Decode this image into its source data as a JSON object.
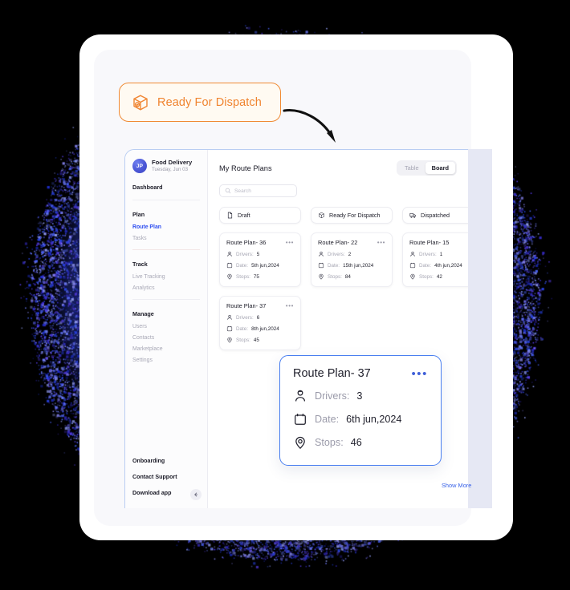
{
  "callout": {
    "label": "Ready For Dispatch",
    "icon": "package-box-icon",
    "accent": "#f08430",
    "bg": "#fffaf2"
  },
  "annotation": {
    "icon": "curved-arrow-icon"
  },
  "sidebar": {
    "profile": {
      "initials": "JP",
      "name": "Food Delivery",
      "date": "Tuesday, Jun 03"
    },
    "dashboard_label": "Dashboard",
    "groups": [
      {
        "title": "Plan",
        "items": [
          {
            "label": "Route Plan",
            "active": true
          },
          {
            "label": "Tasks",
            "active": false
          }
        ]
      },
      {
        "title": "Track",
        "items": [
          {
            "label": "Live Tracking",
            "active": false
          },
          {
            "label": "Analytics",
            "active": false
          }
        ]
      },
      {
        "title": "Manage",
        "items": [
          {
            "label": "Users",
            "active": false
          },
          {
            "label": "Contacts",
            "active": false
          },
          {
            "label": "Marketplace",
            "active": false
          },
          {
            "label": "Settings",
            "active": false
          }
        ]
      }
    ],
    "bottom": [
      {
        "label": "Onboarding"
      },
      {
        "label": "Contact Support"
      },
      {
        "label": "Download app"
      }
    ],
    "collapse_icon": "arrow-left-icon"
  },
  "main": {
    "title": "My Route Plans",
    "view_toggle": {
      "options": [
        "Table",
        "Board"
      ],
      "selected": "Board"
    },
    "search": {
      "placeholder": "Search",
      "value": "",
      "icon": "search-icon"
    },
    "columns": [
      {
        "title": "Draft",
        "icon": "file-icon",
        "cards": [
          {
            "title": "Route Plan- 36",
            "drivers_label": "Drivers:",
            "drivers": "5",
            "date_label": "Date:",
            "date": "5th jun,2024",
            "stops_label": "Stops:",
            "stops": "75",
            "menu_icon": "more-horizontal-icon"
          },
          {
            "title": "Route Plan- 37",
            "drivers_label": "Drivers:",
            "drivers": "6",
            "date_label": "Date:",
            "date": "8th jun,2024",
            "stops_label": "Stops:",
            "stops": "45",
            "menu_icon": "more-horizontal-icon"
          }
        ]
      },
      {
        "title": "Ready For Dispatch",
        "icon": "package-box-icon",
        "cards": [
          {
            "title": "Route Plan- 22",
            "drivers_label": "Drivers:",
            "drivers": "2",
            "date_label": "Date:",
            "date": "15th jun,2024",
            "stops_label": "Stops:",
            "stops": "84",
            "menu_icon": "more-horizontal-icon"
          }
        ]
      },
      {
        "title": "Dispatched",
        "icon": "truck-icon",
        "cards": [
          {
            "title": "Route Plan- 15",
            "drivers_label": "Drivers:",
            "drivers": "1",
            "date_label": "Date:",
            "date": "4th jun,2024",
            "stops_label": "Stops:",
            "stops": "42",
            "menu_icon": "more-horizontal-icon"
          }
        ]
      }
    ],
    "show_more": "Show More"
  },
  "zoom_card": {
    "title": "Route Plan- 37",
    "menu_icon": "more-horizontal-icon",
    "drivers_label": "Drivers:",
    "drivers": "3",
    "date_label": "Date:",
    "date": "6th jun,2024",
    "stops_label": "Stops:",
    "stops": "46",
    "border_color": "#4a7ff0"
  }
}
